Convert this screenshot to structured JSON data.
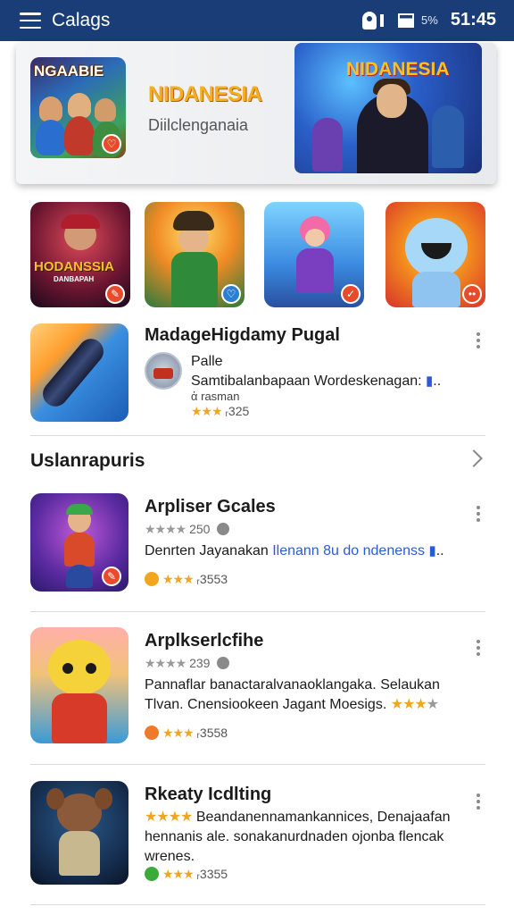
{
  "app_bar": {
    "title": "Calags",
    "battery_pct": "5%",
    "clock": "51:45"
  },
  "banner": {
    "thumb_label": "NGAABIE",
    "title": "NIDANESIA",
    "subtitle": "Diilclenganaia",
    "art_label": "NIDANESIA"
  },
  "icon_row": [
    {
      "label": "HODANSSIA",
      "sublabel": "DANBAPAH"
    },
    {
      "label": ""
    },
    {
      "label": ""
    },
    {
      "label": ""
    }
  ],
  "featured": {
    "title": "MadageHigdamy Pugal",
    "developer": "Palle",
    "description": "Samtibalanbapaan Wordeskenagan:",
    "small": "ἀ rasman",
    "rating_stars": "★★★",
    "rating_value": "ᵣ325"
  },
  "section": {
    "title": "Uslanrapuris"
  },
  "items": [
    {
      "title": "Arpliser Gcales",
      "meta_stars": "★★★★",
      "meta_value": "250",
      "desc_part1": "Denrten Jayanakan ",
      "desc_link": "Ilenann 8u do ndenenss",
      "rating_stars": "★★★",
      "rating_value": "ᵣ3553"
    },
    {
      "title": "Arplkserlcfihe",
      "meta_stars": "★★★★",
      "meta_value": "239",
      "desc_line1": "Pannaflar banactaralvanaoklangaka. Selaukan",
      "desc_line2": "Tlvan. Cnensiookeen Jagant Moesigs.",
      "desc_stars": "★★★",
      "rating_stars": "★★★",
      "rating_value": "ᵣ3558"
    },
    {
      "title": "Rkeaty Icdlting",
      "meta_stars": "★★★★",
      "desc_line1": "Beandanennamankannices, Denajaafan",
      "desc_line2": "hennanis ale. sonakanurdnaden ojonba flencak",
      "desc_line3": "wrenes.",
      "rating_stars": "★★★",
      "rating_value": "ᵣ3355"
    }
  ],
  "colors": {
    "app_bar": "#1a3d78",
    "banner_title": "#f2b01e",
    "star": "#f2a51e",
    "link": "#2a5bd7"
  }
}
